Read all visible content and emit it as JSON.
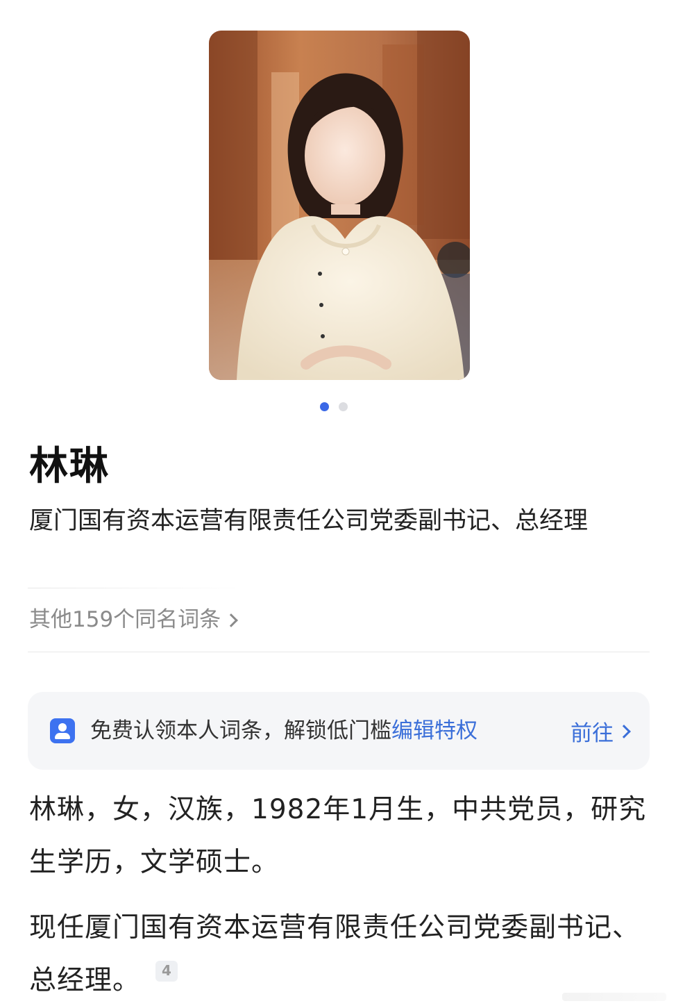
{
  "profile": {
    "name": "林琳",
    "title": "厦门国有资本运营有限责任公司党委副书记、总经理",
    "photo_alt": "portrait photo",
    "carousel": {
      "count": 2,
      "active": 1
    }
  },
  "same_name": {
    "label": "其他159个同名词条"
  },
  "claim_banner": {
    "icon": "person-card-icon",
    "text": "免费认领本人词条，解锁低门槛",
    "link_text": "编辑特权",
    "action_label": "前往"
  },
  "intro": {
    "paragraph1": "林琳，女，汉族，1982年1月生，中共党员，研究生学历，文学硕士。",
    "paragraph2": "现任厦门国有资本运营有限责任公司党委副书记、总经理。",
    "citation": "4"
  },
  "colors": {
    "accent": "#3b6fd9",
    "dot_active": "#3a68e6",
    "dot_inactive": "#dcdde1",
    "card_bg": "#f5f6f8"
  }
}
